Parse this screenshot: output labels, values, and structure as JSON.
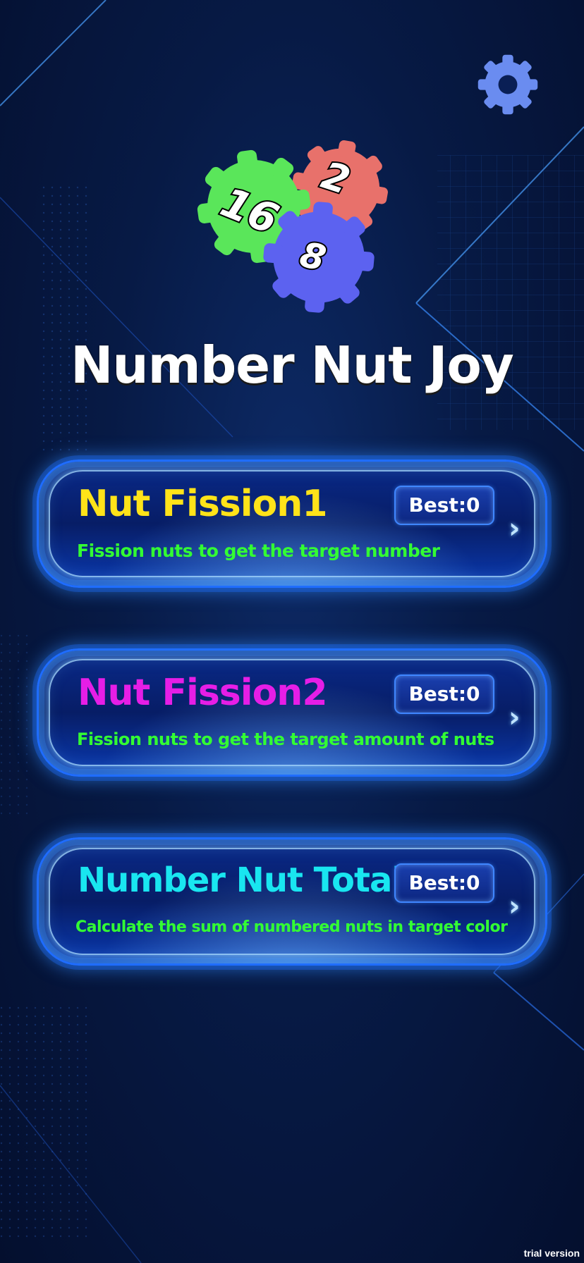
{
  "app": {
    "title": "Number Nut Joy",
    "footer_label": "trial version"
  },
  "logo": {
    "nuts": [
      {
        "number": "16",
        "color": "#5ae65a"
      },
      {
        "number": "2",
        "color": "#e8716b"
      },
      {
        "number": "8",
        "color": "#5c62f0"
      }
    ]
  },
  "settings": {
    "icon": "gear-icon",
    "color": "#6a8cf0"
  },
  "modes": [
    {
      "title": "Nut Fission1",
      "title_color": "#ffe319",
      "description": "Fission nuts to get the target number",
      "best": "Best:0"
    },
    {
      "title": "Nut Fission2",
      "title_color": "#e61ee6",
      "description": "Fission nuts to get the target amount of nuts",
      "best": "Best:0"
    },
    {
      "title": "Number Nut Total",
      "title_color": "#19e6f0",
      "description": "Calculate the sum of numbered nuts in target color",
      "best": "Best:0"
    }
  ],
  "colors": {
    "background": "#071a45",
    "accent_blue": "#1f6dff",
    "description_green": "#33ff33"
  }
}
